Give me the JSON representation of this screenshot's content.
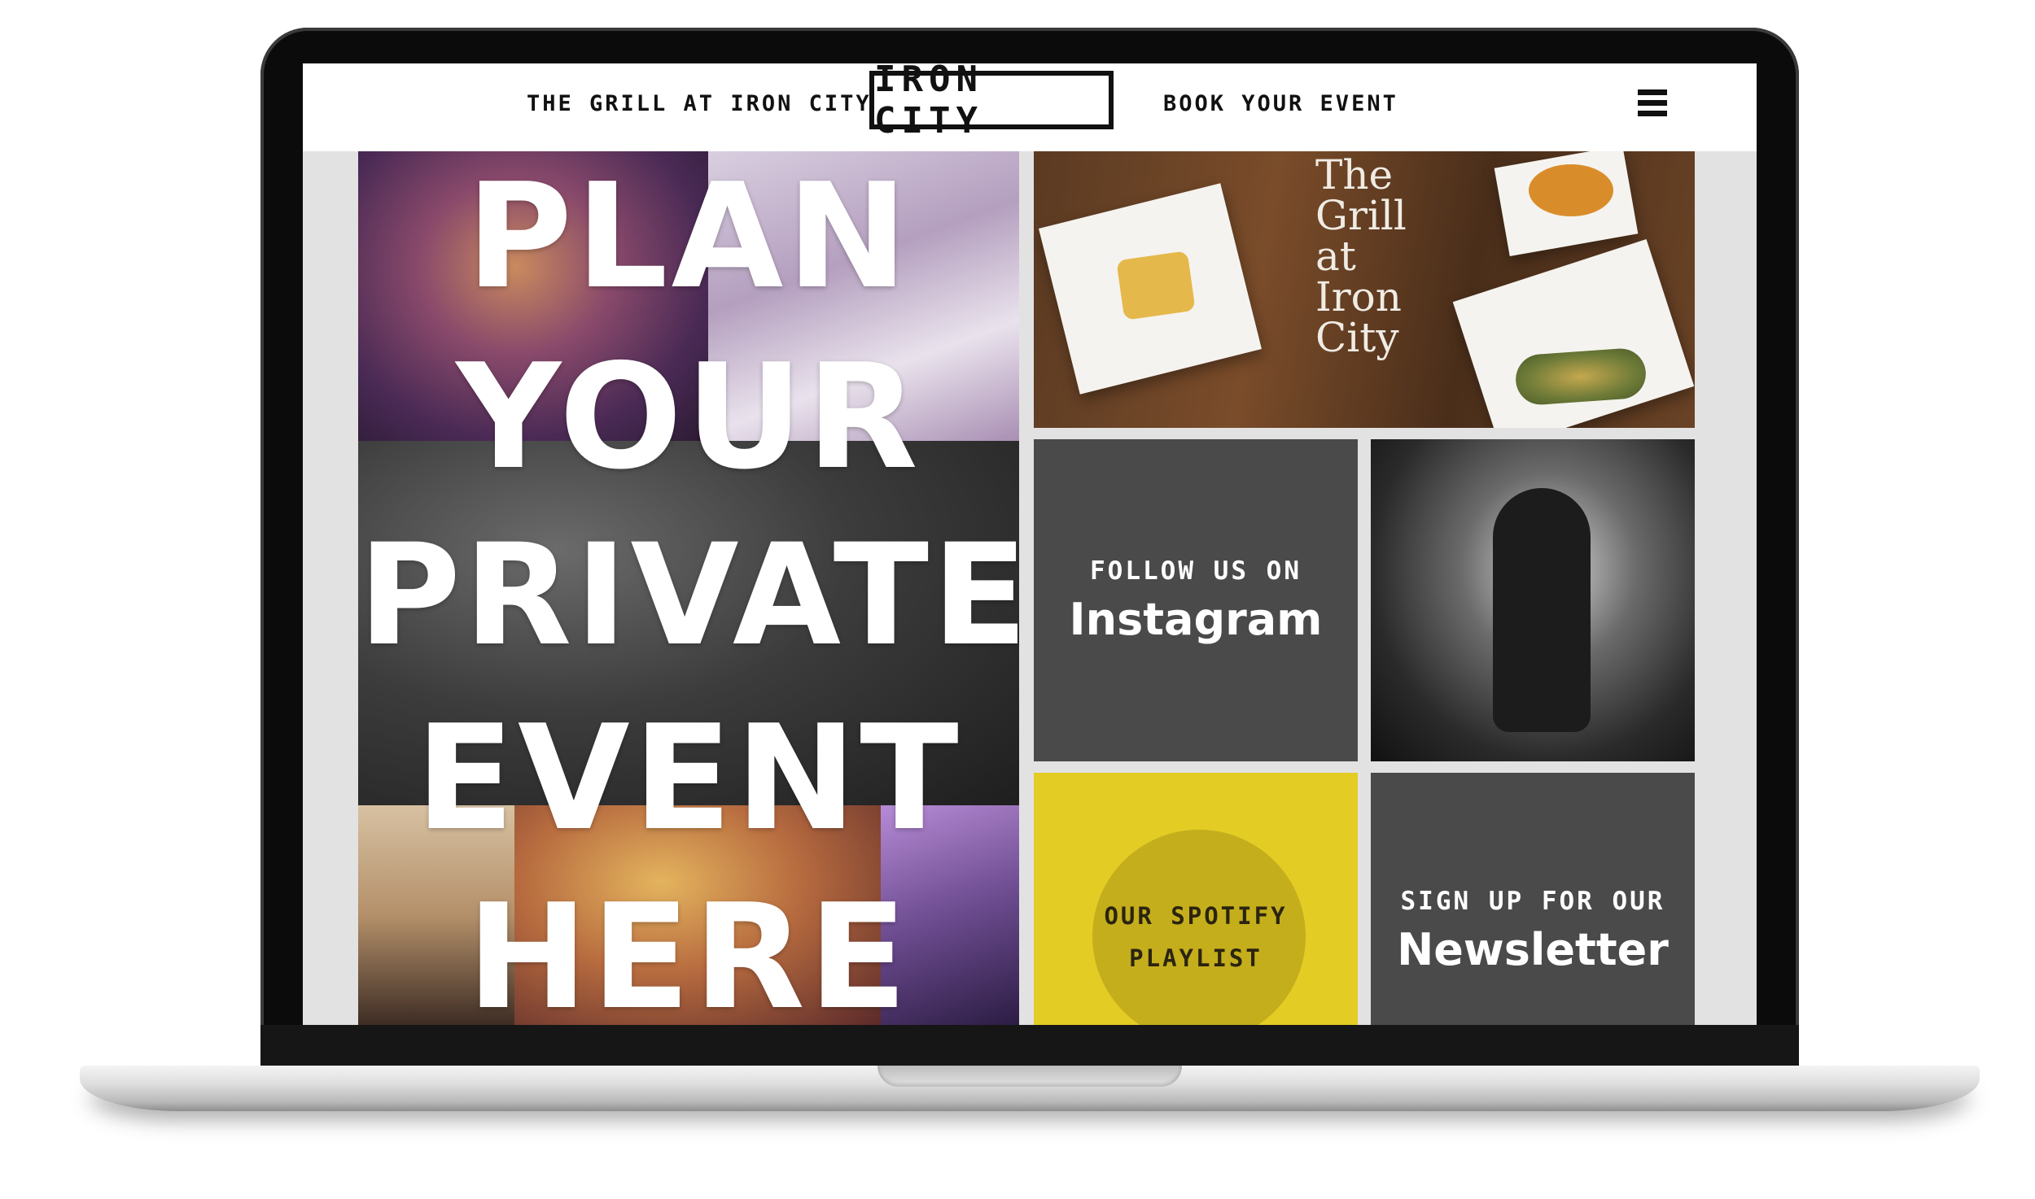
{
  "header": {
    "nav_left": "THE GRILL AT IRON CITY",
    "logo": "IRON CITY",
    "nav_right": "BOOK YOUR EVENT",
    "menu_icon": "hamburger-menu-icon"
  },
  "hero": {
    "lines": [
      "PLAN",
      "YOUR",
      "PRIVATE",
      "EVENT",
      "HERE"
    ]
  },
  "food_tile": {
    "caption_lines": [
      "The",
      "Grill",
      "at",
      "Iron",
      "City"
    ]
  },
  "instagram_tile": {
    "small": "FOLLOW US ON",
    "big": "Instagram"
  },
  "spotify_tile": {
    "line1": "OUR SPOTIFY",
    "line2": "PLAYLIST"
  },
  "newsletter_tile": {
    "small": "SIGN UP FOR OUR",
    "big": "Newsletter"
  },
  "colors": {
    "spotify_yellow": "#e3cc24",
    "tile_gray": "#4a4a4a",
    "background_gray": "#e2e2e2"
  }
}
